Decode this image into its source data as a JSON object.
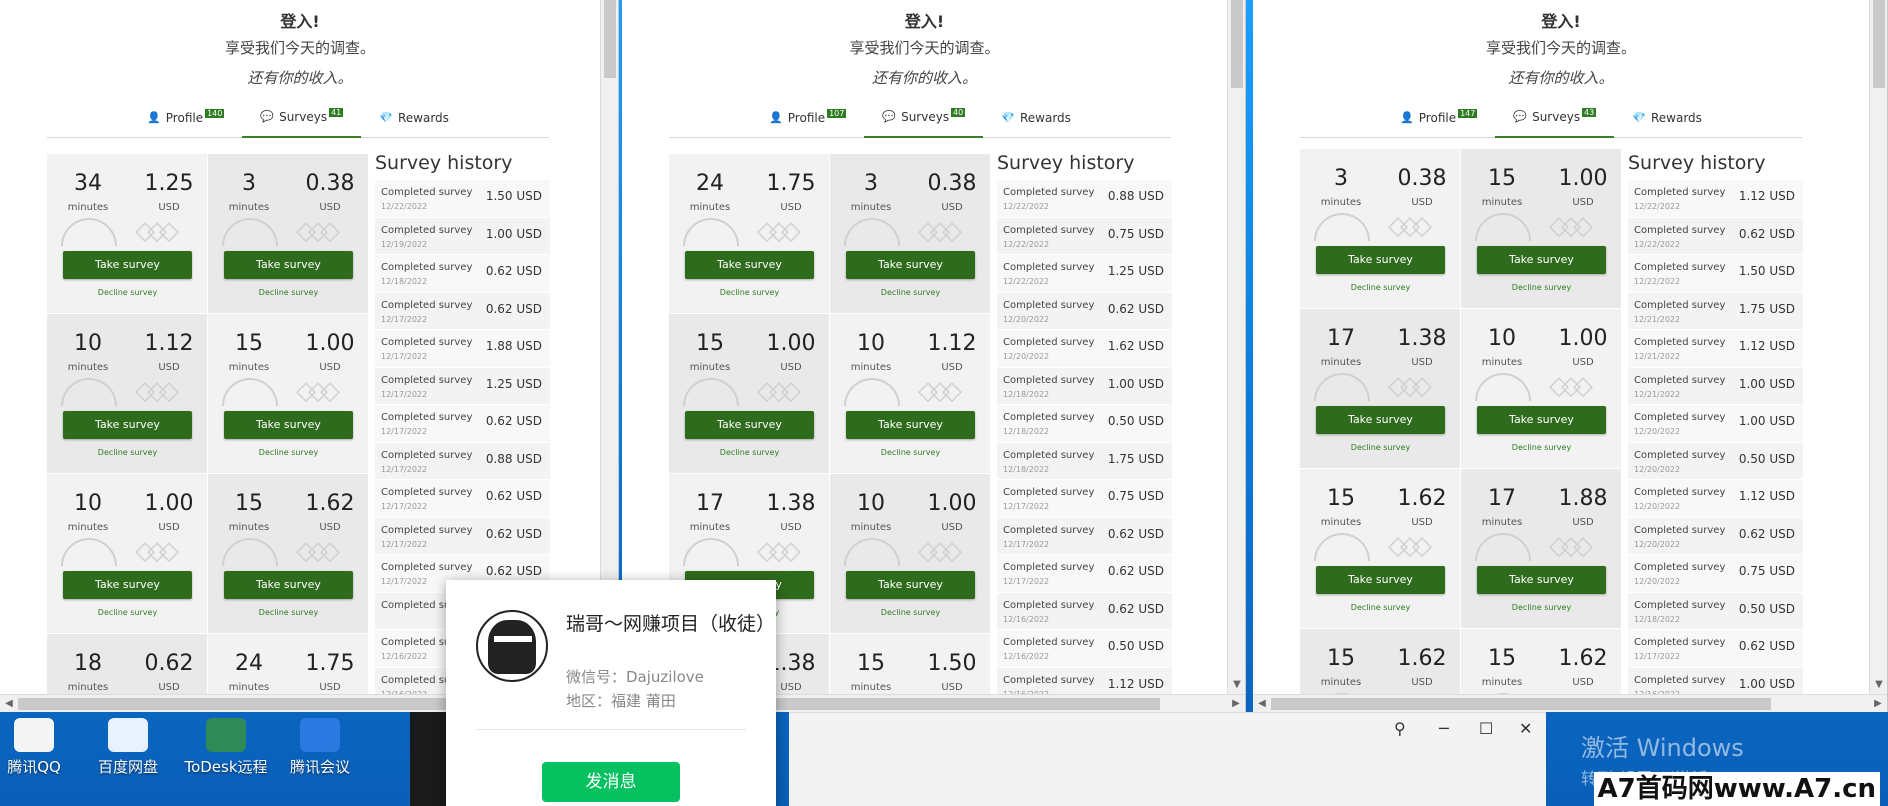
{
  "windows": [
    {
      "header": {
        "title": "登入!",
        "line1": "享受我们今天的调查。",
        "line2": "还有你的收入。"
      },
      "tabs": [
        {
          "label": "Profile",
          "badge": "140"
        },
        {
          "label": "Surveys",
          "badge": "41"
        },
        {
          "label": "Rewards",
          "badge": ""
        }
      ],
      "cards": [
        {
          "minutes": "34",
          "usd": "1.25"
        },
        {
          "minutes": "3",
          "usd": "0.38"
        },
        {
          "minutes": "10",
          "usd": "1.12"
        },
        {
          "minutes": "15",
          "usd": "1.00"
        },
        {
          "minutes": "10",
          "usd": "1.00"
        },
        {
          "minutes": "15",
          "usd": "1.62"
        },
        {
          "minutes": "18",
          "usd": "0.62"
        },
        {
          "minutes": "24",
          "usd": "1.75"
        }
      ],
      "history": [
        {
          "amount": "1.50 USD",
          "date": "12/22/2022"
        },
        {
          "amount": "1.00 USD",
          "date": "12/19/2022"
        },
        {
          "amount": "0.62 USD",
          "date": "12/18/2022"
        },
        {
          "amount": "0.62 USD",
          "date": "12/17/2022"
        },
        {
          "amount": "1.88 USD",
          "date": "12/17/2022"
        },
        {
          "amount": "1.25 USD",
          "date": "12/17/2022"
        },
        {
          "amount": "0.62 USD",
          "date": "12/17/2022"
        },
        {
          "amount": "0.88 USD",
          "date": "12/17/2022"
        },
        {
          "amount": "0.62 USD",
          "date": "12/17/2022"
        },
        {
          "amount": "0.62 USD",
          "date": "12/17/2022"
        },
        {
          "amount": "0.62 USD",
          "date": "12/17/2022"
        },
        {
          "amount": "",
          "date": ""
        },
        {
          "amount": "",
          "date": "12/16/2022"
        },
        {
          "amount": "",
          "date": "12/16/2022"
        }
      ]
    },
    {
      "header": {
        "title": "登入!",
        "line1": "享受我们今天的调查。",
        "line2": "还有你的收入。"
      },
      "tabs": [
        {
          "label": "Profile",
          "badge": "107"
        },
        {
          "label": "Surveys",
          "badge": "40"
        },
        {
          "label": "Rewards",
          "badge": ""
        }
      ],
      "cards": [
        {
          "minutes": "24",
          "usd": "1.75"
        },
        {
          "minutes": "3",
          "usd": "0.38"
        },
        {
          "minutes": "15",
          "usd": "1.00"
        },
        {
          "minutes": "10",
          "usd": "1.12"
        },
        {
          "minutes": "17",
          "usd": "1.38"
        },
        {
          "minutes": "10",
          "usd": "1.00"
        },
        {
          "minutes": "",
          "usd": "1.38"
        },
        {
          "minutes": "15",
          "usd": "1.50"
        }
      ],
      "history": [
        {
          "amount": "0.88 USD",
          "date": "12/22/2022"
        },
        {
          "amount": "0.75 USD",
          "date": "12/22/2022"
        },
        {
          "amount": "1.25 USD",
          "date": "12/22/2022"
        },
        {
          "amount": "0.62 USD",
          "date": "12/20/2022"
        },
        {
          "amount": "1.62 USD",
          "date": "12/20/2022"
        },
        {
          "amount": "1.00 USD",
          "date": "12/18/2022"
        },
        {
          "amount": "0.50 USD",
          "date": "12/18/2022"
        },
        {
          "amount": "1.75 USD",
          "date": "12/18/2022"
        },
        {
          "amount": "0.75 USD",
          "date": "12/17/2022"
        },
        {
          "amount": "0.62 USD",
          "date": "12/17/2022"
        },
        {
          "amount": "0.62 USD",
          "date": "12/17/2022"
        },
        {
          "amount": "0.62 USD",
          "date": "12/16/2022"
        },
        {
          "amount": "0.50 USD",
          "date": "12/16/2022"
        },
        {
          "amount": "1.12 USD",
          "date": "12/16/2022"
        }
      ]
    },
    {
      "header": {
        "title": "登入!",
        "line1": "享受我们今天的调查。",
        "line2": "还有你的收入。"
      },
      "tabs": [
        {
          "label": "Profile",
          "badge": "147"
        },
        {
          "label": "Surveys",
          "badge": "43"
        },
        {
          "label": "Rewards",
          "badge": ""
        }
      ],
      "cards": [
        {
          "minutes": "3",
          "usd": "0.38"
        },
        {
          "minutes": "15",
          "usd": "1.00"
        },
        {
          "minutes": "17",
          "usd": "1.38"
        },
        {
          "minutes": "10",
          "usd": "1.00"
        },
        {
          "minutes": "15",
          "usd": "1.62"
        },
        {
          "minutes": "17",
          "usd": "1.88"
        },
        {
          "minutes": "15",
          "usd": "1.62"
        },
        {
          "minutes": "15",
          "usd": "1.62"
        }
      ],
      "history": [
        {
          "amount": "1.12 USD",
          "date": "12/22/2022"
        },
        {
          "amount": "0.62 USD",
          "date": "12/22/2022"
        },
        {
          "amount": "1.50 USD",
          "date": "12/22/2022"
        },
        {
          "amount": "1.75 USD",
          "date": "12/21/2022"
        },
        {
          "amount": "1.12 USD",
          "date": "12/21/2022"
        },
        {
          "amount": "1.00 USD",
          "date": "12/21/2022"
        },
        {
          "amount": "1.00 USD",
          "date": "12/20/2022"
        },
        {
          "amount": "0.50 USD",
          "date": "12/20/2022"
        },
        {
          "amount": "1.12 USD",
          "date": "12/20/2022"
        },
        {
          "amount": "0.62 USD",
          "date": "12/20/2022"
        },
        {
          "amount": "0.75 USD",
          "date": "12/20/2022"
        },
        {
          "amount": "0.50 USD",
          "date": "12/18/2022"
        },
        {
          "amount": "0.62 USD",
          "date": "12/17/2022"
        },
        {
          "amount": "1.00 USD",
          "date": "12/16/2022"
        }
      ]
    }
  ],
  "labels": {
    "minutes": "minutes",
    "usd": "USD",
    "take_survey": "Take survey",
    "decline_survey": "Decline survey",
    "history_title": "Survey history",
    "completed": "Completed survey"
  },
  "desktop_icons": [
    "腾讯QQ",
    "百度网盘",
    "ToDesk远程",
    "腾讯会议"
  ],
  "popup": {
    "name": "瑞哥～网赚项目（收徒）",
    "wechat_id": "微信号：Dajuzilove",
    "region": "地区：福建 莆田",
    "send_button": "发消息"
  },
  "activate": {
    "line1": "激活 Windows",
    "line2": "转到\"设置\"以激活 Windows。"
  },
  "watermark": "A7首码网www.A7.cn",
  "colors": {
    "accent_green": "#2f6b1c",
    "wechat_green": "#07c160",
    "desktop_blue": "#0a78d6"
  }
}
